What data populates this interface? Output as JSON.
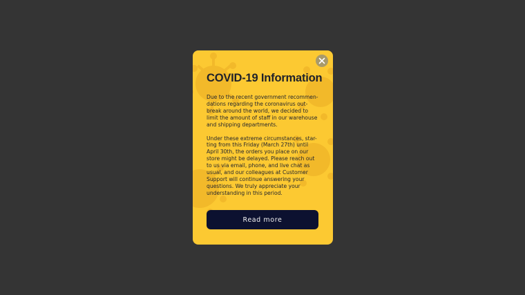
{
  "colors": {
    "backdrop": "#343434",
    "modal_background": "#fcc932",
    "virus_pattern": "#f2b92a",
    "text": "#23252d",
    "button_background": "#0c1130",
    "button_text": "#f2f2f2",
    "close_button_background": "#a89a6a"
  },
  "modal": {
    "close_icon": "close-icon",
    "title": "COVID-19 Information",
    "paragraph1": [
      "Due to the recent government recommen-",
      "dations regarding the coronavirus out-",
      "break around the world, we decided to",
      "limit the amount of staff in our warehouse",
      "and shipping departments."
    ],
    "paragraph2": [
      "Under these extreme circumstances, star-",
      "ting from this Friday (March 27th) until",
      "April 30th, the orders you place on our",
      "store might be delayed. Please reach out",
      "to us via email, phone, and live chat as",
      "usual, and our colleagues at Customer",
      "Support will continue answering your",
      "questions. We truly appreciate your",
      "understanding in this period."
    ],
    "button_label": "Read more"
  }
}
